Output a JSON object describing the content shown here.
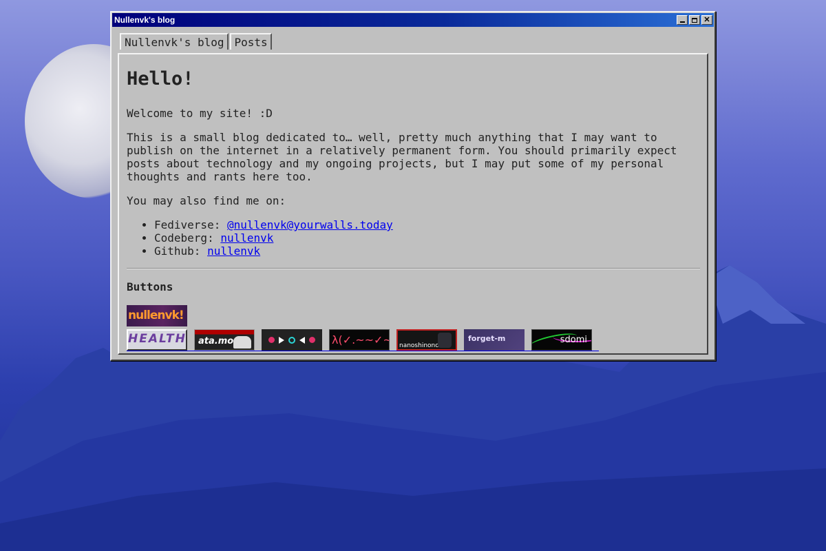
{
  "window": {
    "title": "Nullenvk's blog"
  },
  "tabs": [
    {
      "label": "Nullenvk's blog"
    },
    {
      "label": "Posts"
    }
  ],
  "content": {
    "heading": "Hello!",
    "intro": "Welcome to my site! :D",
    "description": "This is a small blog dedicated to… well, pretty much anything that I may want to publish on the internet in a relatively permanent form. You should primarily expect posts about technology and my ongoing projects, but I may put some of my personal thoughts and rants here too.",
    "find_me": "You may also find me on:",
    "links": [
      {
        "label": "Fediverse:",
        "link_text": "@nullenvk@yourwalls.today"
      },
      {
        "label": "Codeberg:",
        "link_text": "nullenvk"
      },
      {
        "label": "Github:",
        "link_text": "nullenvk"
      }
    ],
    "buttons_heading": "Buttons",
    "badges": [
      {
        "text": "nullenvk!"
      },
      {
        "text": "HEALTH"
      },
      {
        "text": "ata.moe"
      },
      {
        "text": "λ(✓.~~✓~)✓≡ω"
      },
      {
        "text": "nanoshinono.me"
      },
      {
        "text": "forget-m"
      },
      {
        "text": "sdomi"
      }
    ]
  },
  "colors": {
    "link": "#0000ee",
    "titlebar_start": "#00007b",
    "window_bg": "#c0c0c0"
  }
}
